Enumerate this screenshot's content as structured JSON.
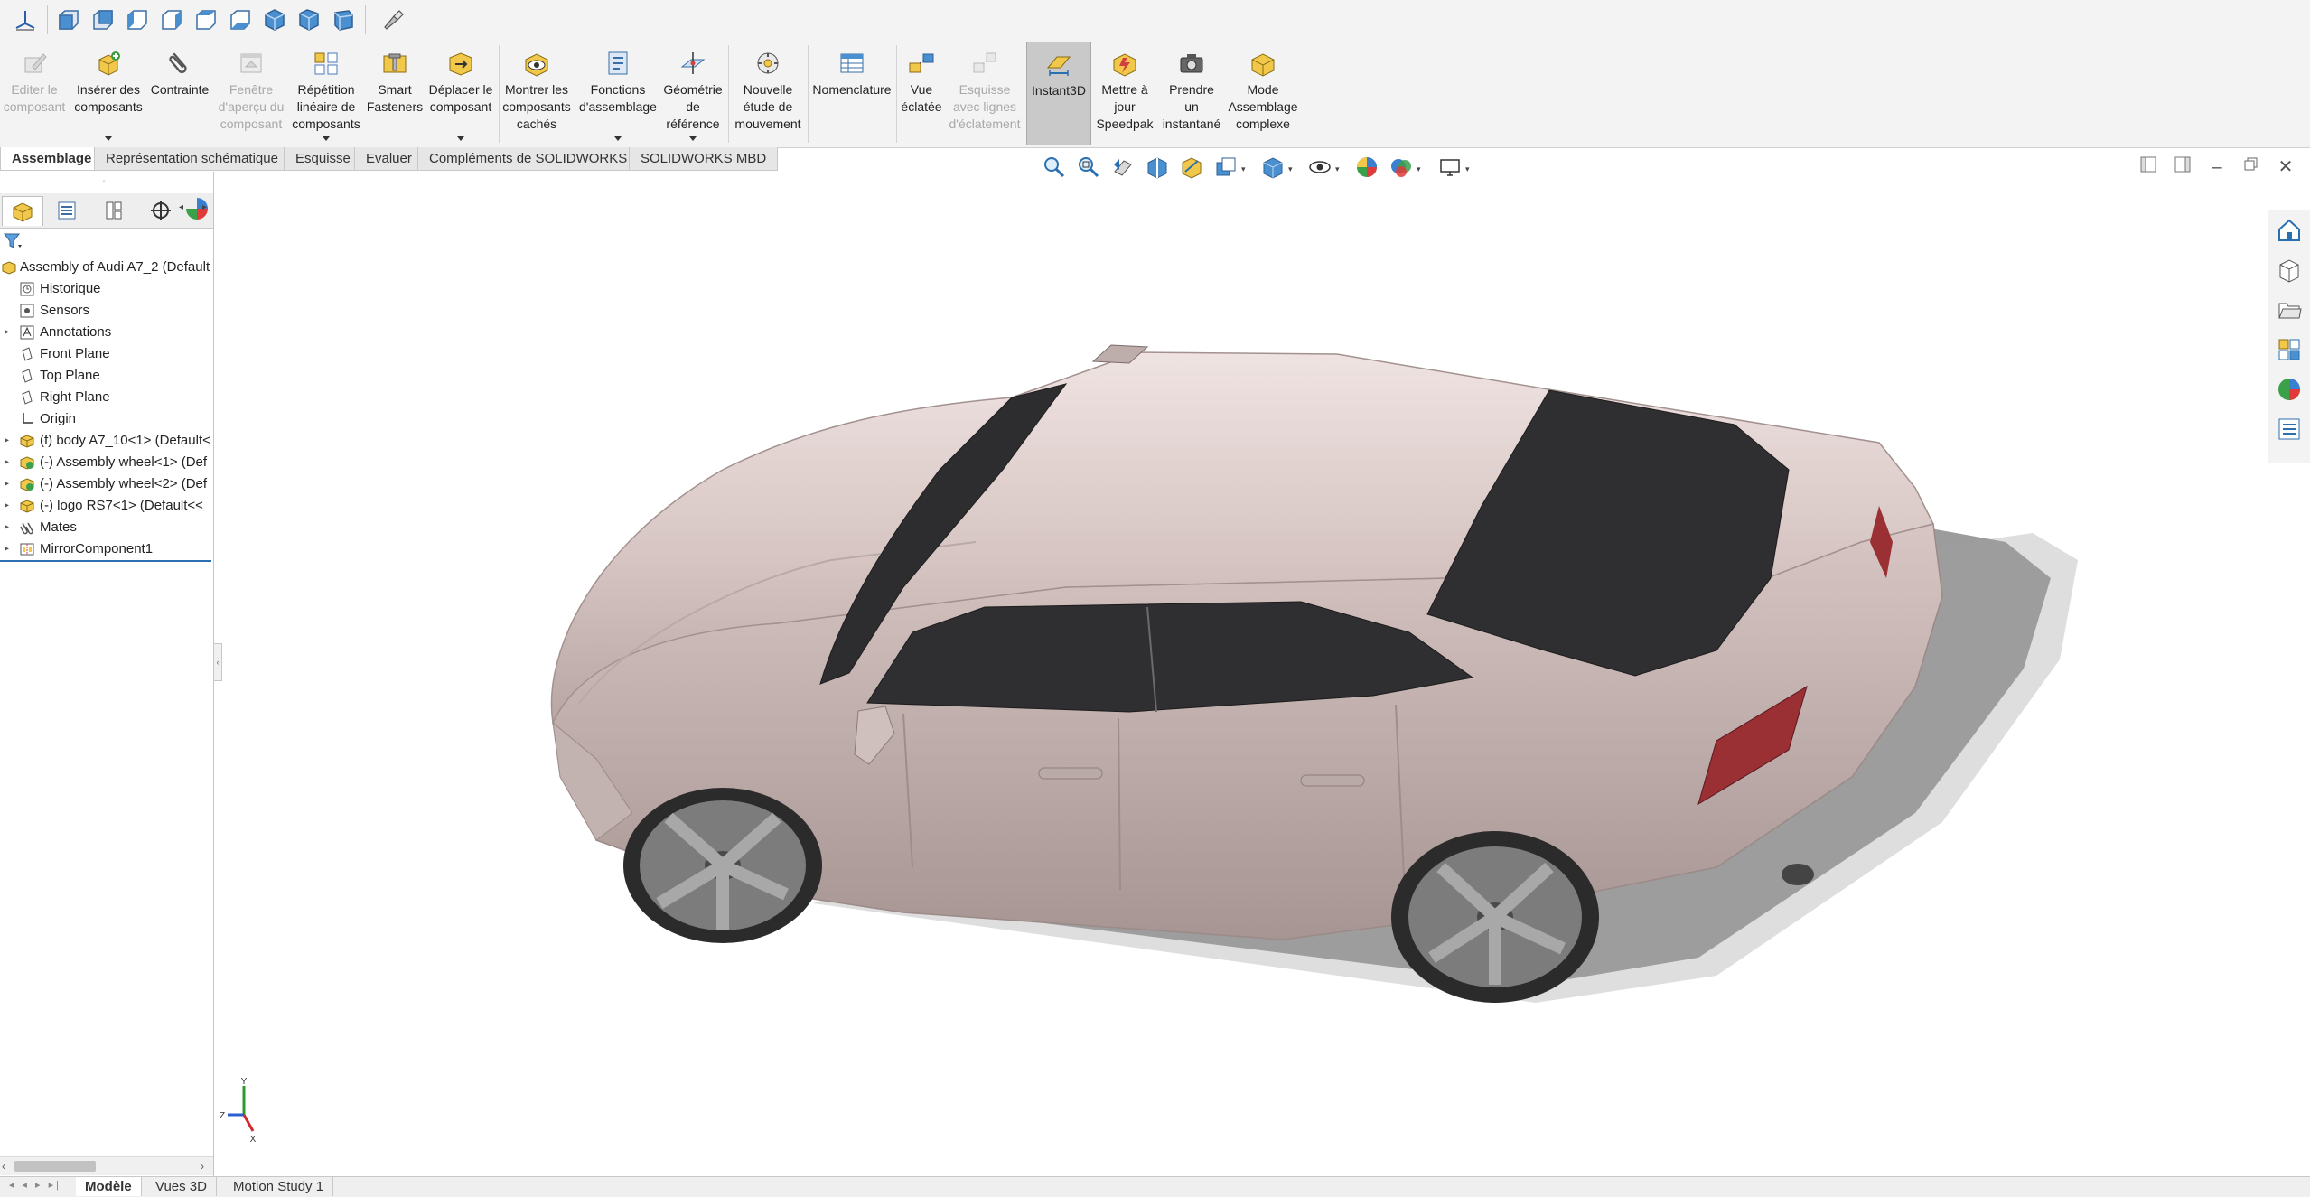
{
  "view_toolbar": {
    "icons": [
      "origin-axis-icon",
      "front-view-icon",
      "back-view-icon",
      "left-view-icon",
      "right-view-icon",
      "top-view-icon",
      "bottom-view-icon",
      "isometric-view-icon",
      "trimetric-view-icon",
      "dimetric-view-icon",
      "flashlight-icon"
    ]
  },
  "ribbon": {
    "items": [
      {
        "label": "Editer le\ncomposant",
        "icon": "edit-component-icon",
        "disabled": true
      },
      {
        "label": "Insérer des\ncomposants",
        "icon": "insert-components-icon",
        "disabled": false,
        "dropdown": true
      },
      {
        "label": "Contrainte",
        "icon": "mate-paperclip-icon",
        "disabled": false
      },
      {
        "label": "Fenêtre\nd'aperçu du\ncomposant",
        "icon": "component-preview-icon",
        "disabled": true
      },
      {
        "label": "Répétition\nlinéaire de\ncomposants",
        "icon": "linear-pattern-icon",
        "disabled": false,
        "dropdown": true
      },
      {
        "label": "Smart\nFasteners",
        "icon": "smart-fasteners-icon",
        "disabled": false
      },
      {
        "label": "Déplacer le\ncomposant",
        "icon": "move-component-icon",
        "disabled": false,
        "dropdown": true
      },
      {
        "label": "Montrer les\ncomposants\ncachés",
        "icon": "show-hidden-icon",
        "disabled": false
      },
      {
        "label": "Fonctions\nd'assemblage",
        "icon": "assembly-features-icon",
        "disabled": false,
        "dropdown": true
      },
      {
        "label": "Géométrie\nde\nréférence",
        "icon": "reference-geometry-icon",
        "disabled": false,
        "dropdown": true
      },
      {
        "label": "Nouvelle\nétude de\nmouvement",
        "icon": "motion-study-icon",
        "disabled": false
      },
      {
        "label": "Nomenclature",
        "icon": "bill-of-materials-icon",
        "disabled": false
      },
      {
        "label": "Vue\néclatée",
        "icon": "exploded-view-icon",
        "disabled": false
      },
      {
        "label": "Esquisse\navec lignes\nd'éclatement",
        "icon": "explode-line-sketch-icon",
        "disabled": true
      },
      {
        "label": "Instant3D",
        "icon": "instant3d-icon",
        "disabled": false,
        "active": true
      },
      {
        "label": "Mettre à\njour\nSpeedpak",
        "icon": "speedpak-icon",
        "disabled": false
      },
      {
        "label": "Prendre\nun\ninstantané",
        "icon": "snapshot-camera-icon",
        "disabled": false
      },
      {
        "label": "Mode\nAssemblage\ncomplexe",
        "icon": "large-assembly-icon",
        "disabled": false
      }
    ]
  },
  "tabs": [
    "Assemblage",
    "Représentation schématique",
    "Esquisse",
    "Evaluer",
    "Compléments de SOLIDWORKS",
    "SOLIDWORKS MBD"
  ],
  "selected_tab": "Assemblage",
  "feature_tree": {
    "root": "Assembly of Audi A7_2  (Default",
    "items": [
      {
        "label": "Historique",
        "icon": "history-icon",
        "expandable": false
      },
      {
        "label": "Sensors",
        "icon": "sensor-icon",
        "expandable": false
      },
      {
        "label": "Annotations",
        "icon": "annotations-icon",
        "expandable": true
      },
      {
        "label": "Front Plane",
        "icon": "plane-icon",
        "expandable": false
      },
      {
        "label": "Top Plane",
        "icon": "plane-icon",
        "expandable": false
      },
      {
        "label": "Right Plane",
        "icon": "plane-icon",
        "expandable": false
      },
      {
        "label": "Origin",
        "icon": "origin-icon",
        "expandable": false
      },
      {
        "label": "(f) body A7_10<1> (Default<",
        "icon": "part-icon",
        "expandable": true
      },
      {
        "label": "(-) Assembly wheel<1> (Def",
        "icon": "subassembly-icon",
        "expandable": true
      },
      {
        "label": "(-) Assembly wheel<2> (Def",
        "icon": "subassembly-icon",
        "expandable": true
      },
      {
        "label": "(-) logo RS7<1> (Default<<",
        "icon": "part-icon",
        "expandable": true
      },
      {
        "label": "Mates",
        "icon": "mates-icon",
        "expandable": true
      },
      {
        "label": "MirrorComponent1",
        "icon": "mirror-component-icon",
        "expandable": true
      }
    ]
  },
  "bottom_tabs": [
    "Modèle",
    "Vues 3D",
    "Motion Study 1"
  ],
  "selected_bottom_tab": "Modèle",
  "triad": {
    "x": "X",
    "y": "Y",
    "z": "Z"
  },
  "colors": {
    "car_body": "#d9c8c6",
    "glass": "#2f2f31",
    "accent_blue": "#2a6fb0"
  }
}
